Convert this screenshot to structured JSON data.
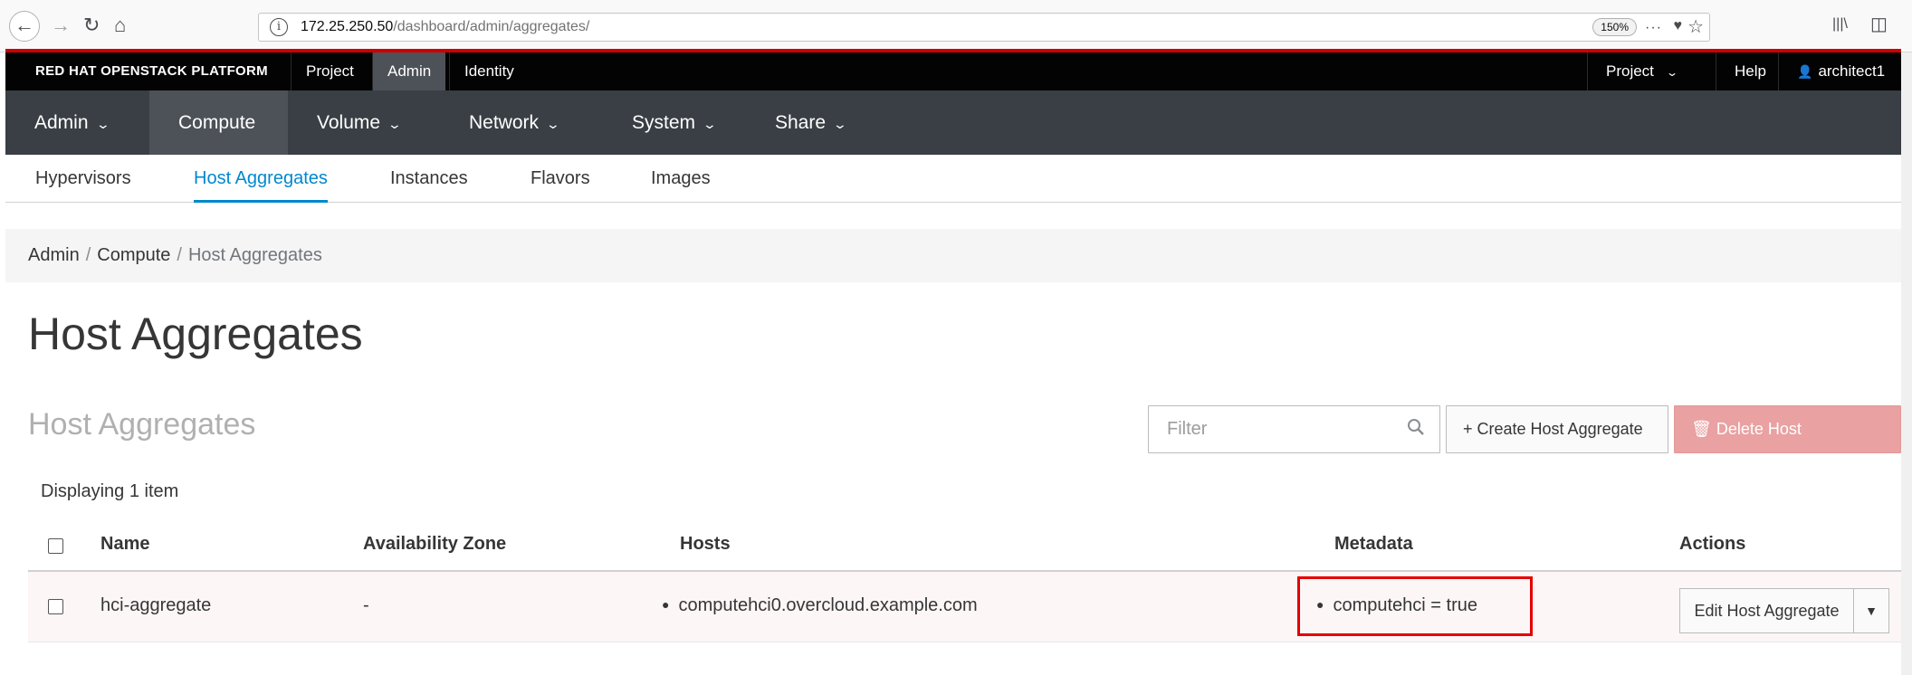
{
  "browser": {
    "url_host": "172.25.250.50",
    "url_path": "/dashboard/admin/aggregates/",
    "zoom": "150%",
    "back_icon": "←",
    "forward_icon": "→",
    "reload_icon": "↻",
    "home_icon": "⌂",
    "info_icon": "i",
    "more_icon": "···",
    "pocket_icon": "♥",
    "star_icon": "☆",
    "library_icon": "|||\\",
    "sidebar_icon": "◫"
  },
  "masthead": {
    "brand": "RED HAT OPENSTACK PLATFORM",
    "tabs": [
      {
        "label": "Project"
      },
      {
        "label": "Admin"
      },
      {
        "label": "Identity"
      }
    ],
    "project_menu": "Project",
    "help": "Help",
    "user": "architect1",
    "user_icon": "👤"
  },
  "nav": {
    "items": [
      {
        "label": "Admin"
      },
      {
        "label": "Compute"
      },
      {
        "label": "Volume"
      },
      {
        "label": "Network"
      },
      {
        "label": "System"
      },
      {
        "label": "Share"
      }
    ],
    "caret": "⌄"
  },
  "subnav": {
    "items": [
      {
        "label": "Hypervisors"
      },
      {
        "label": "Host Aggregates"
      },
      {
        "label": "Instances"
      },
      {
        "label": "Flavors"
      },
      {
        "label": "Images"
      }
    ]
  },
  "breadcrumb": {
    "items": [
      "Admin",
      "Compute",
      "Host Aggregates"
    ],
    "separator": "/"
  },
  "page": {
    "title": "Host Aggregates",
    "section_title": "Host Aggregates",
    "filter_placeholder": "Filter",
    "create_button": "+ Create Host Aggregate",
    "delete_button": "🗑 Delete Host Aggregates",
    "display_count": "Displaying 1 item"
  },
  "table": {
    "headers": [
      "Name",
      "Availability Zone",
      "Hosts",
      "Metadata",
      "Actions"
    ],
    "rows": [
      {
        "name": "hci-aggregate",
        "availability_zone": "-",
        "hosts": "computehci0.overcloud.example.com",
        "metadata": "computehci = true",
        "action": "Edit Host Aggregate",
        "action_caret": "▼"
      }
    ]
  },
  "colors": {
    "accent": "#0088ce",
    "masthead": "#030303",
    "navbar": "#393f44",
    "danger": "#e9a1a1",
    "highlight": "#e50000"
  }
}
